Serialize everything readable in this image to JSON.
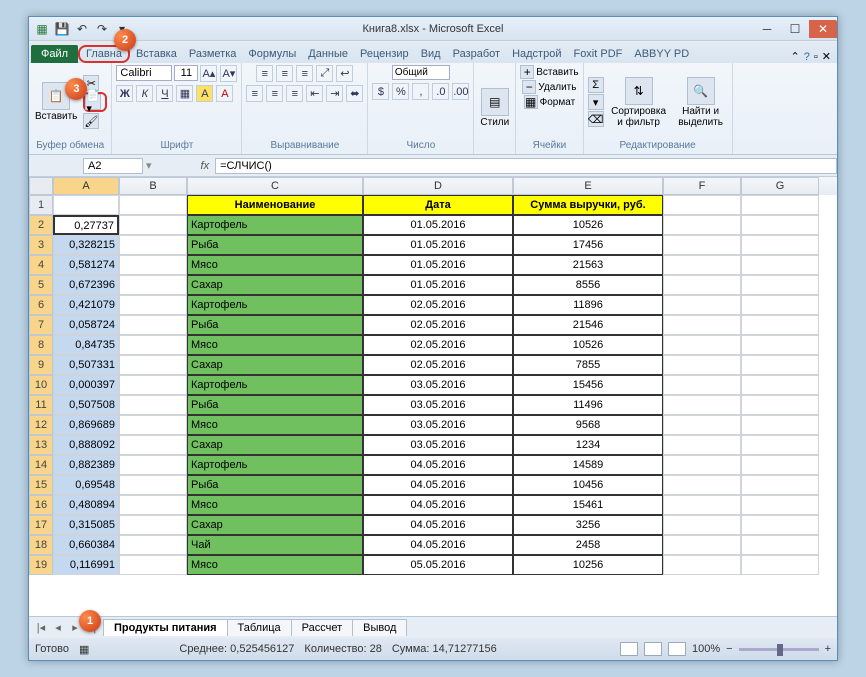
{
  "title": {
    "filename": "Книга8.xlsx",
    "app": "Microsoft Excel",
    "full": "Книга8.xlsx  -  Microsoft Excel"
  },
  "tabs": {
    "file": "Файл",
    "home": "Главна",
    "insert": "Вставка",
    "layout": "Разметка",
    "formulas": "Формулы",
    "data": "Данные",
    "review": "Рецензир",
    "view": "Вид",
    "dev": "Разработ",
    "addins": "Надстрой",
    "foxit": "Foxit PDF",
    "abbyy": "ABBYY PD"
  },
  "ribbon": {
    "paste": "Вставить",
    "clipboard": "Буфер обмена",
    "font_name": "Calibri",
    "font_size": "11",
    "font_group": "Шрифт",
    "align_group": "Выравнивание",
    "number_format": "Общий",
    "number_group": "Число",
    "styles": "Стили",
    "ins": "Вставить",
    "del": "Удалить",
    "fmt": "Формат",
    "cells_group": "Ячейки",
    "sort": "Сортировка и фильтр",
    "find": "Найти и выделить",
    "edit_group": "Редактирование"
  },
  "namebox": "A2",
  "formula": "=СЛЧИС()",
  "columns": [
    "A",
    "B",
    "C",
    "D",
    "E",
    "F",
    "G"
  ],
  "table_header": {
    "c": "Наименование",
    "d": "Дата",
    "e": "Сумма выручки, руб."
  },
  "rows": [
    {
      "n": 1,
      "a": "",
      "c": "",
      "d": "",
      "e": "",
      "hdr": true
    },
    {
      "n": 2,
      "a": "0,27737",
      "c": "Картофель",
      "d": "01.05.2016",
      "e": "10526",
      "active": true
    },
    {
      "n": 3,
      "a": "0,328215",
      "c": "Рыба",
      "d": "01.05.2016",
      "e": "17456"
    },
    {
      "n": 4,
      "a": "0,581274",
      "c": "Мясо",
      "d": "01.05.2016",
      "e": "21563"
    },
    {
      "n": 5,
      "a": "0,672396",
      "c": "Сахар",
      "d": "01.05.2016",
      "e": "8556"
    },
    {
      "n": 6,
      "a": "0,421079",
      "c": "Картофель",
      "d": "02.05.2016",
      "e": "11896"
    },
    {
      "n": 7,
      "a": "0,058724",
      "c": "Рыба",
      "d": "02.05.2016",
      "e": "21546"
    },
    {
      "n": 8,
      "a": "0,84735",
      "c": "Мясо",
      "d": "02.05.2016",
      "e": "10526"
    },
    {
      "n": 9,
      "a": "0,507331",
      "c": "Сахар",
      "d": "02.05.2016",
      "e": "7855"
    },
    {
      "n": 10,
      "a": "0,000397",
      "c": "Картофель",
      "d": "03.05.2016",
      "e": "15456"
    },
    {
      "n": 11,
      "a": "0,507508",
      "c": "Рыба",
      "d": "03.05.2016",
      "e": "11496"
    },
    {
      "n": 12,
      "a": "0,869689",
      "c": "Мясо",
      "d": "03.05.2016",
      "e": "9568"
    },
    {
      "n": 13,
      "a": "0,888092",
      "c": "Сахар",
      "d": "03.05.2016",
      "e": "1234"
    },
    {
      "n": 14,
      "a": "0,882389",
      "c": "Картофель",
      "d": "04.05.2016",
      "e": "14589"
    },
    {
      "n": 15,
      "a": "0,69548",
      "c": "Рыба",
      "d": "04.05.2016",
      "e": "10456"
    },
    {
      "n": 16,
      "a": "0,480894",
      "c": "Мясо",
      "d": "04.05.2016",
      "e": "15461"
    },
    {
      "n": 17,
      "a": "0,315085",
      "c": "Сахар",
      "d": "04.05.2016",
      "e": "3256"
    },
    {
      "n": 18,
      "a": "0,660384",
      "c": "Чай",
      "d": "04.05.2016",
      "e": "2458"
    },
    {
      "n": 19,
      "a": "0,116991",
      "c": "Мясо",
      "d": "05.05.2016",
      "e": "10256"
    }
  ],
  "sheets": {
    "active": "Продукты питания",
    "s2": "Таблица",
    "s3": "Рассчет",
    "s4": "Вывод"
  },
  "status": {
    "ready": "Готово",
    "avg_label": "Среднее:",
    "avg": "0,525456127",
    "count_label": "Количество:",
    "count": "28",
    "sum_label": "Сумма:",
    "sum": "14,71277156",
    "zoom": "100%"
  },
  "callouts": {
    "c1": "1",
    "c2": "2",
    "c3": "3"
  }
}
